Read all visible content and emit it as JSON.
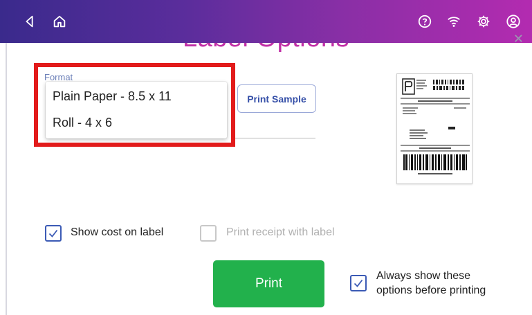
{
  "header": {
    "back_icon": "back-icon",
    "home_icon": "home-icon",
    "help_icon": "help-icon",
    "wifi_icon": "wifi-icon",
    "settings_icon": "gear-icon",
    "account_icon": "account-icon"
  },
  "page": {
    "title": "Label Options"
  },
  "format": {
    "label": "Format",
    "options": [
      "Plain Paper - 8.5 x 11",
      "Roll - 4 x 6"
    ]
  },
  "print_sample": {
    "label": "Print Sample"
  },
  "options": {
    "show_cost": {
      "label": "Show cost on label",
      "checked": true
    },
    "print_receipt": {
      "label": "Print receipt with label",
      "checked": false,
      "disabled": true
    },
    "always_show": {
      "line1": "Always show these",
      "line2": "options before printing",
      "checked": true
    }
  },
  "print_button": {
    "label": "Print"
  },
  "colors": {
    "header_start": "#3a2a8c",
    "header_end": "#b32bb0",
    "title": "#c12ea6",
    "highlight": "#e21b1b",
    "print_button": "#22b14c",
    "checkbox": "#3b5ab5"
  }
}
